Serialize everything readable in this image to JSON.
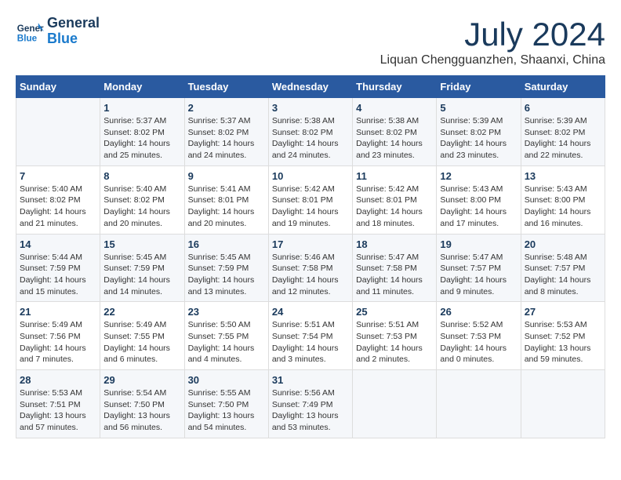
{
  "logo": {
    "line1": "General",
    "line2": "Blue"
  },
  "title": "July 2024",
  "subtitle": "Liquan Chengguanzhen, Shaanxi, China",
  "headers": [
    "Sunday",
    "Monday",
    "Tuesday",
    "Wednesday",
    "Thursday",
    "Friday",
    "Saturday"
  ],
  "weeks": [
    [
      {
        "day": "",
        "info": ""
      },
      {
        "day": "1",
        "info": "Sunrise: 5:37 AM\nSunset: 8:02 PM\nDaylight: 14 hours\nand 25 minutes."
      },
      {
        "day": "2",
        "info": "Sunrise: 5:37 AM\nSunset: 8:02 PM\nDaylight: 14 hours\nand 24 minutes."
      },
      {
        "day": "3",
        "info": "Sunrise: 5:38 AM\nSunset: 8:02 PM\nDaylight: 14 hours\nand 24 minutes."
      },
      {
        "day": "4",
        "info": "Sunrise: 5:38 AM\nSunset: 8:02 PM\nDaylight: 14 hours\nand 23 minutes."
      },
      {
        "day": "5",
        "info": "Sunrise: 5:39 AM\nSunset: 8:02 PM\nDaylight: 14 hours\nand 23 minutes."
      },
      {
        "day": "6",
        "info": "Sunrise: 5:39 AM\nSunset: 8:02 PM\nDaylight: 14 hours\nand 22 minutes."
      }
    ],
    [
      {
        "day": "7",
        "info": "Sunrise: 5:40 AM\nSunset: 8:02 PM\nDaylight: 14 hours\nand 21 minutes."
      },
      {
        "day": "8",
        "info": "Sunrise: 5:40 AM\nSunset: 8:02 PM\nDaylight: 14 hours\nand 20 minutes."
      },
      {
        "day": "9",
        "info": "Sunrise: 5:41 AM\nSunset: 8:01 PM\nDaylight: 14 hours\nand 20 minutes."
      },
      {
        "day": "10",
        "info": "Sunrise: 5:42 AM\nSunset: 8:01 PM\nDaylight: 14 hours\nand 19 minutes."
      },
      {
        "day": "11",
        "info": "Sunrise: 5:42 AM\nSunset: 8:01 PM\nDaylight: 14 hours\nand 18 minutes."
      },
      {
        "day": "12",
        "info": "Sunrise: 5:43 AM\nSunset: 8:00 PM\nDaylight: 14 hours\nand 17 minutes."
      },
      {
        "day": "13",
        "info": "Sunrise: 5:43 AM\nSunset: 8:00 PM\nDaylight: 14 hours\nand 16 minutes."
      }
    ],
    [
      {
        "day": "14",
        "info": "Sunrise: 5:44 AM\nSunset: 7:59 PM\nDaylight: 14 hours\nand 15 minutes."
      },
      {
        "day": "15",
        "info": "Sunrise: 5:45 AM\nSunset: 7:59 PM\nDaylight: 14 hours\nand 14 minutes."
      },
      {
        "day": "16",
        "info": "Sunrise: 5:45 AM\nSunset: 7:59 PM\nDaylight: 14 hours\nand 13 minutes."
      },
      {
        "day": "17",
        "info": "Sunrise: 5:46 AM\nSunset: 7:58 PM\nDaylight: 14 hours\nand 12 minutes."
      },
      {
        "day": "18",
        "info": "Sunrise: 5:47 AM\nSunset: 7:58 PM\nDaylight: 14 hours\nand 11 minutes."
      },
      {
        "day": "19",
        "info": "Sunrise: 5:47 AM\nSunset: 7:57 PM\nDaylight: 14 hours\nand 9 minutes."
      },
      {
        "day": "20",
        "info": "Sunrise: 5:48 AM\nSunset: 7:57 PM\nDaylight: 14 hours\nand 8 minutes."
      }
    ],
    [
      {
        "day": "21",
        "info": "Sunrise: 5:49 AM\nSunset: 7:56 PM\nDaylight: 14 hours\nand 7 minutes."
      },
      {
        "day": "22",
        "info": "Sunrise: 5:49 AM\nSunset: 7:55 PM\nDaylight: 14 hours\nand 6 minutes."
      },
      {
        "day": "23",
        "info": "Sunrise: 5:50 AM\nSunset: 7:55 PM\nDaylight: 14 hours\nand 4 minutes."
      },
      {
        "day": "24",
        "info": "Sunrise: 5:51 AM\nSunset: 7:54 PM\nDaylight: 14 hours\nand 3 minutes."
      },
      {
        "day": "25",
        "info": "Sunrise: 5:51 AM\nSunset: 7:53 PM\nDaylight: 14 hours\nand 2 minutes."
      },
      {
        "day": "26",
        "info": "Sunrise: 5:52 AM\nSunset: 7:53 PM\nDaylight: 14 hours\nand 0 minutes."
      },
      {
        "day": "27",
        "info": "Sunrise: 5:53 AM\nSunset: 7:52 PM\nDaylight: 13 hours\nand 59 minutes."
      }
    ],
    [
      {
        "day": "28",
        "info": "Sunrise: 5:53 AM\nSunset: 7:51 PM\nDaylight: 13 hours\nand 57 minutes."
      },
      {
        "day": "29",
        "info": "Sunrise: 5:54 AM\nSunset: 7:50 PM\nDaylight: 13 hours\nand 56 minutes."
      },
      {
        "day": "30",
        "info": "Sunrise: 5:55 AM\nSunset: 7:50 PM\nDaylight: 13 hours\nand 54 minutes."
      },
      {
        "day": "31",
        "info": "Sunrise: 5:56 AM\nSunset: 7:49 PM\nDaylight: 13 hours\nand 53 minutes."
      },
      {
        "day": "",
        "info": ""
      },
      {
        "day": "",
        "info": ""
      },
      {
        "day": "",
        "info": ""
      }
    ]
  ]
}
